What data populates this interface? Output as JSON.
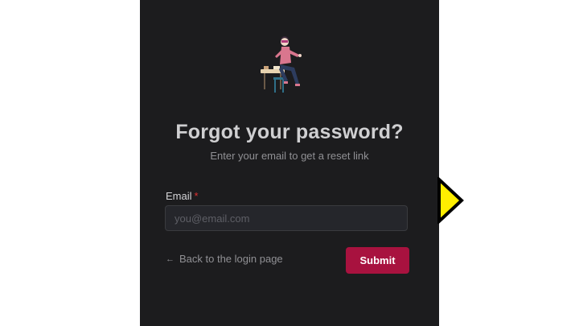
{
  "form": {
    "title": "Forgot your password?",
    "subtitle": "Enter your email to get a reset link",
    "email_label": "Email",
    "required_marker": "*",
    "email_placeholder": "you@email.com",
    "back_arrow": "←",
    "back_label": "Back to the login page",
    "submit_label": "Submit"
  },
  "colors": {
    "panel": "#1c1c1e",
    "accent": "#a8123f",
    "pointer": "#ffee00"
  },
  "icons": {
    "illustration": "woman-sitting-on-table-illustration",
    "pointer": "yellow-arrow-pointer",
    "back": "arrow-left-icon"
  }
}
